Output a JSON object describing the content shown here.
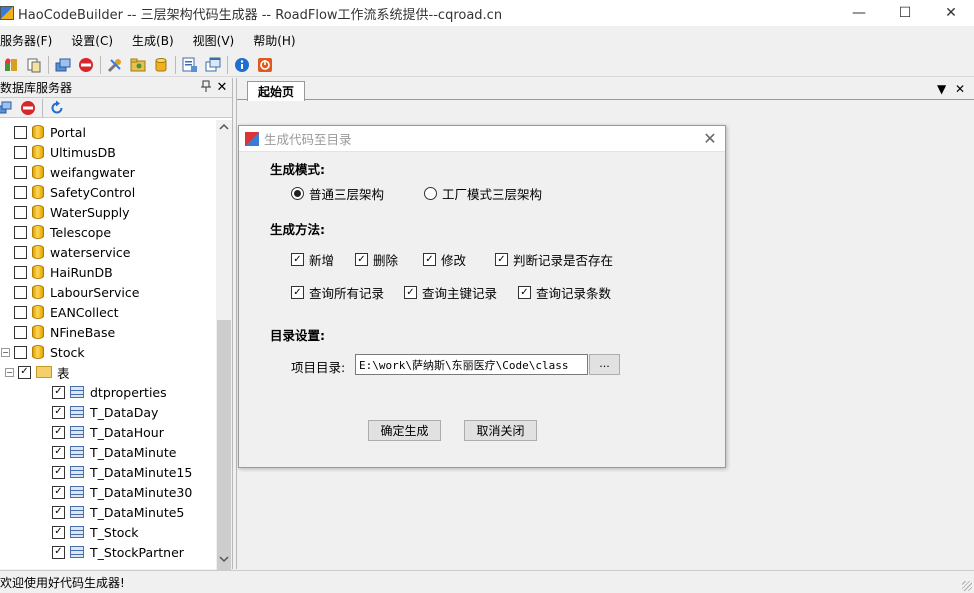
{
  "window": {
    "title": "HaoCodeBuilder -- 三层架构代码生成器 -- RoadFlow工作流系统提供--cqroad.cn",
    "minimize_glyph": "—",
    "maximize_glyph": "☐",
    "close_glyph": "✕"
  },
  "menu": [
    {
      "label": "服务器(F)"
    },
    {
      "label": "设置(C)"
    },
    {
      "label": "生成(B)"
    },
    {
      "label": "视图(V)"
    },
    {
      "label": "帮助(H)"
    }
  ],
  "toolbar": {
    "icons": [
      "add-server-icon",
      "copy-icon",
      "connect-icon",
      "stop-icon",
      "tools-icon",
      "folder-icon",
      "database-icon",
      "export-icon",
      "window-icon",
      "info-icon",
      "exit-icon"
    ]
  },
  "left_panel": {
    "title": "数据库服务器",
    "pin_glyph": "📌",
    "close_glyph": "✕",
    "tree": [
      {
        "label": "Portal",
        "type": "database",
        "checked": false,
        "level": 1
      },
      {
        "label": "UltimusDB",
        "type": "database",
        "checked": false,
        "level": 1
      },
      {
        "label": "weifangwater",
        "type": "database",
        "checked": false,
        "level": 1
      },
      {
        "label": "SafetyControl",
        "type": "database",
        "checked": false,
        "level": 1
      },
      {
        "label": "WaterSupply",
        "type": "database",
        "checked": false,
        "level": 1
      },
      {
        "label": "Telescope",
        "type": "database",
        "checked": false,
        "level": 1
      },
      {
        "label": "waterservice",
        "type": "database",
        "checked": false,
        "level": 1
      },
      {
        "label": "HaiRunDB",
        "type": "database",
        "checked": false,
        "level": 1
      },
      {
        "label": "LabourService",
        "type": "database",
        "checked": false,
        "level": 1
      },
      {
        "label": "EANCollect",
        "type": "database",
        "checked": false,
        "level": 1
      },
      {
        "label": "NFineBase",
        "type": "database",
        "checked": false,
        "level": 1
      },
      {
        "label": "Stock",
        "type": "database",
        "checked": false,
        "level": 1,
        "expanded": true
      },
      {
        "label": "表",
        "type": "folder",
        "checked": true,
        "level": 2,
        "expanded": true
      },
      {
        "label": "dtproperties",
        "type": "table",
        "checked": true,
        "level": 3
      },
      {
        "label": "T_DataDay",
        "type": "table",
        "checked": true,
        "level": 3
      },
      {
        "label": "T_DataHour",
        "type": "table",
        "checked": true,
        "level": 3
      },
      {
        "label": "T_DataMinute",
        "type": "table",
        "checked": true,
        "level": 3
      },
      {
        "label": "T_DataMinute15",
        "type": "table",
        "checked": true,
        "level": 3
      },
      {
        "label": "T_DataMinute30",
        "type": "table",
        "checked": true,
        "level": 3
      },
      {
        "label": "T_DataMinute5",
        "type": "table",
        "checked": true,
        "level": 3
      },
      {
        "label": "T_Stock",
        "type": "table",
        "checked": true,
        "level": 3
      },
      {
        "label": "T_StockPartner",
        "type": "table",
        "checked": true,
        "level": 3
      }
    ]
  },
  "tabs": {
    "active": "起始页",
    "dropdown_glyph": "▼",
    "close_glyph": "✕"
  },
  "dialog": {
    "title": "生成代码至目录",
    "close_glyph": "✕",
    "mode_label": "生成模式:",
    "modes": [
      {
        "label": "普通三层架构",
        "selected": true
      },
      {
        "label": "工厂模式三层架构",
        "selected": false
      }
    ],
    "method_label": "生成方法:",
    "methods_row1": [
      {
        "label": "新增",
        "checked": true
      },
      {
        "label": "删除",
        "checked": true
      },
      {
        "label": "修改",
        "checked": true
      },
      {
        "label": "判断记录是否存在",
        "checked": true
      }
    ],
    "methods_row2": [
      {
        "label": "查询所有记录",
        "checked": true
      },
      {
        "label": "查询主键记录",
        "checked": true
      },
      {
        "label": "查询记录条数",
        "checked": true
      }
    ],
    "dir_label": "目录设置:",
    "project_dir_label": "项目目录:",
    "project_dir_value": "E:\\work\\萨纳斯\\东丽医疗\\Code\\class",
    "browse_label": "...",
    "ok_label": "确定生成",
    "cancel_label": "取消关闭"
  },
  "status": {
    "text": "欢迎使用好代码生成器!"
  }
}
